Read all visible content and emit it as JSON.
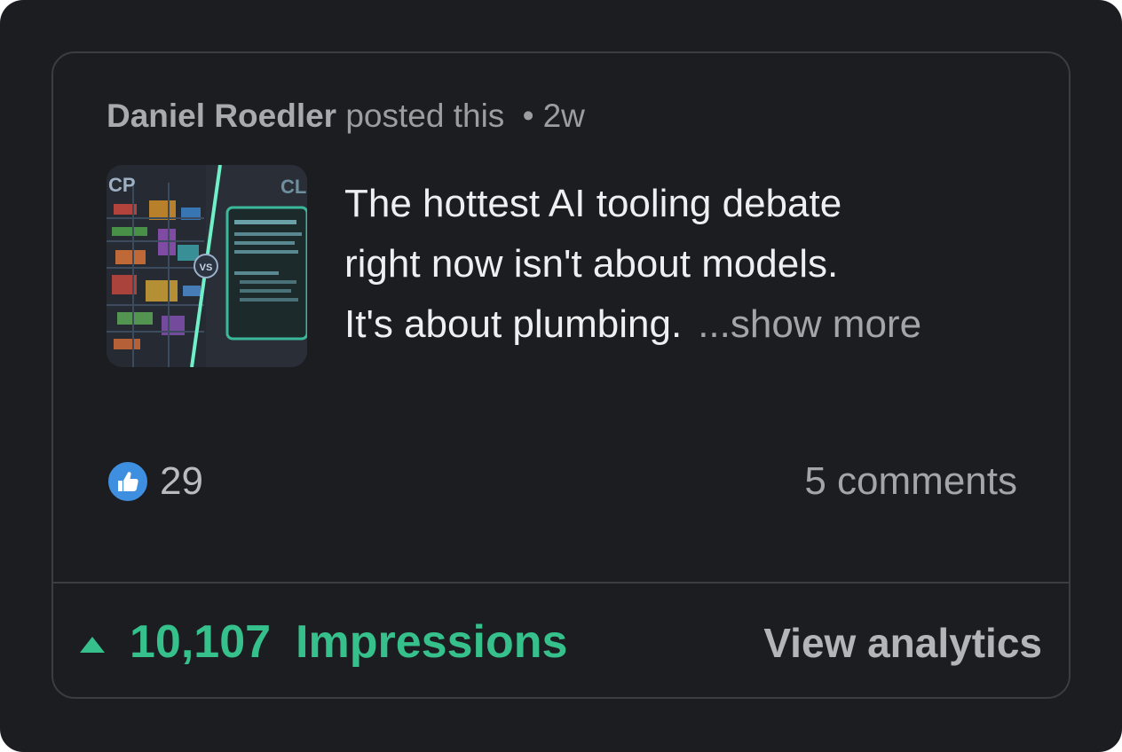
{
  "post": {
    "author": "Daniel Roedler",
    "action": "posted this",
    "separator": "•",
    "age": "2w",
    "thumbnail_labels": {
      "left": "CP",
      "right": "CL",
      "center": "VS"
    },
    "text_lines": [
      "The hottest AI tooling debate",
      "right now isn't about models.",
      "It's about plumbing."
    ],
    "show_more": "...show more"
  },
  "engagement": {
    "reaction_icon": "thumbs-up-icon",
    "reaction_count": "29",
    "comments": "5 comments"
  },
  "footer": {
    "trend_icon": "triangle-up-icon",
    "impressions_count": "10,107",
    "impressions_label": "Impressions",
    "view_analytics": "View analytics"
  },
  "colors": {
    "background": "#1c1d20",
    "card_border": "#3b3d42",
    "accent_green": "#35c08c",
    "like_blue": "#3f8fe0"
  }
}
